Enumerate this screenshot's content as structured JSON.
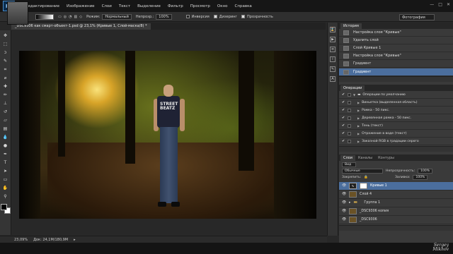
{
  "app": {
    "logo": "Ps"
  },
  "menu": [
    "Редактирование",
    "Изображение",
    "Слои",
    "Текст",
    "Выделение",
    "Фильтр",
    "Просмотр",
    "Окно",
    "Справка"
  ],
  "options": {
    "mode_label": "Режим:",
    "mode_value": "Нормальный",
    "opacity_label": "Непрозр.:",
    "opacity_value": "100%",
    "inverse_label": "Инверсия",
    "dither_label": "Дизеринг",
    "transparency_label": "Прозрачность",
    "workspace": "Фотография"
  },
  "document_tab": "_DSC9306 как смарт-объект-1.psd @ 23,1% (Кривые 1, Слой-маска/8) *",
  "canvas": {
    "shirt_text": "STREET BEATZ"
  },
  "status": {
    "zoom": "23,09%",
    "doc": "Док: 24,1M/180,9M"
  },
  "history": {
    "tab": "История",
    "items": [
      "Настройка слоя \"Кривые\"",
      "Удалить слой",
      "Слой Кривые 1",
      "Настройка слоя \"Кривые\"",
      "Градиент",
      "Градиент"
    ]
  },
  "actions": {
    "tab": "Операции",
    "items": [
      "Операции по умолчанию",
      "Виньетка (выделенная область)",
      "Рамка - 50 пикс.",
      "Деревянная рамка - 50 пикс.",
      "Тень (текст)",
      "Отражение в воде (текст)",
      "Заказной RGB в градации серого"
    ]
  },
  "layers": {
    "tabs": [
      "Слои",
      "Каналы",
      "Контуры"
    ],
    "kind_label": "Вид",
    "blend": "Обычные",
    "opacity_label": "Непрозрачность:",
    "opacity_value": "100%",
    "lock_label": "Закрепить:",
    "fill_label": "Заливка:",
    "fill_value": "100%",
    "items": [
      "Кривые 1",
      "Слой 4",
      "Группа 1",
      "_DSC9306 копия",
      "_DSC9306"
    ]
  },
  "watermark": {
    "line1": "Sergey",
    "line2": "Mikhov"
  },
  "colors": {
    "accent": "#4b6e9d",
    "menubar": "#161616",
    "panel": "#3a3a3a"
  }
}
